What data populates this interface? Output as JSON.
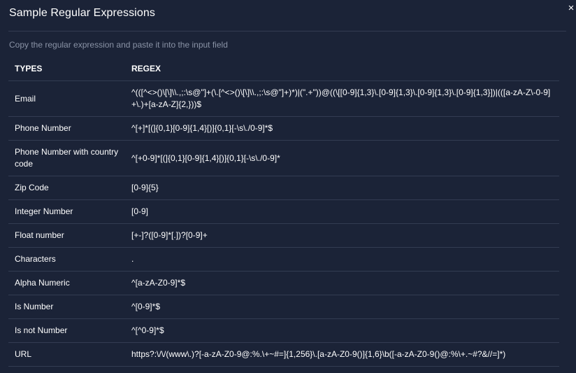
{
  "modal": {
    "title": "Sample Regular Expressions",
    "close_label": "×",
    "subtitle": "Copy the regular expression and paste it into the input field"
  },
  "table": {
    "headers": [
      "TYPES",
      "REGEX"
    ],
    "rows": [
      {
        "type": "Email",
        "regex": "^(([^<>()\\[\\]\\\\.,;:\\s@\"]+(\\.[^<>()\\[\\]\\\\.,;:\\s@\"]+)*)|(\".+\"))@((\\[[0-9]{1,3}\\.[0-9]{1,3}\\.[0-9]{1,3}\\.[0-9]{1,3}])|(([a-zA-Z\\-0-9]+\\.)+[a-zA-Z]{2,}))$"
      },
      {
        "type": "Phone Number",
        "regex": "^[+]*[(]{0,1}[0-9]{1,4}[)]{0,1}[-\\s\\./0-9]*$"
      },
      {
        "type": "Phone Number with country code",
        "regex": "^[+0-9]*[(]{0,1}[0-9]{1,4}[)]{0,1}[-\\s\\./0-9]*"
      },
      {
        "type": "Zip Code",
        "regex": "[0-9]{5}"
      },
      {
        "type": "Integer Number",
        "regex": "[0-9]"
      },
      {
        "type": "Float number",
        "regex": "[+-]?([0-9]*[.])?[0-9]+"
      },
      {
        "type": "Characters",
        "regex": "."
      },
      {
        "type": "Alpha Numeric",
        "regex": "^[a-zA-Z0-9]*$"
      },
      {
        "type": "Is Number",
        "regex": "^[0-9]*$"
      },
      {
        "type": "Is not Number",
        "regex": "^[^0-9]*$"
      },
      {
        "type": "URL",
        "regex": "https?:\\/\\/(www\\.)?[-a-zA-Z0-9@:%.\\+~#=]{1,256}\\.[a-zA-Z0-9()]{1,6}\\b([-a-zA-Z0-9()@:%\\+.~#?&//=]*)"
      }
    ]
  },
  "colors": {
    "background": "#1b2337",
    "divider": "#333c52",
    "subtitle": "#8a93a6",
    "text": "#ffffff"
  }
}
